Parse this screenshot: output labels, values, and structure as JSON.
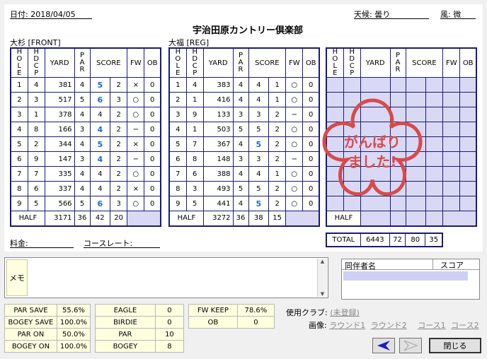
{
  "header": {
    "date_label": "日付: 2018/04/05",
    "weather_label": "天候: 曇り",
    "wind_label": "風: 微",
    "course_name": "宇治田原カントリー倶楽部"
  },
  "front": {
    "label": "大杉 [FRONT]",
    "columns": [
      "HOLE",
      "HDCP",
      "YARD",
      "PAR",
      "SCORE",
      "FW",
      "OB"
    ],
    "rows": [
      {
        "hole": "1",
        "hdcp": "4",
        "yard": "381",
        "par": "4",
        "score": "5",
        "putt": "2",
        "fw": "×",
        "ob": "0"
      },
      {
        "hole": "2",
        "hdcp": "3",
        "yard": "517",
        "par": "5",
        "score": "6",
        "putt": "3",
        "fw": "○",
        "ob": "0"
      },
      {
        "hole": "3",
        "hdcp": "1",
        "yard": "378",
        "par": "4",
        "score": "4",
        "putt": "2",
        "fw": "○",
        "ob": "0"
      },
      {
        "hole": "4",
        "hdcp": "8",
        "yard": "166",
        "par": "3",
        "score": "4",
        "putt": "2",
        "fw": "−",
        "ob": "0"
      },
      {
        "hole": "5",
        "hdcp": "2",
        "yard": "344",
        "par": "4",
        "score": "5",
        "putt": "2",
        "fw": "×",
        "ob": "0"
      },
      {
        "hole": "6",
        "hdcp": "9",
        "yard": "147",
        "par": "3",
        "score": "4",
        "putt": "2",
        "fw": "−",
        "ob": "0"
      },
      {
        "hole": "7",
        "hdcp": "7",
        "yard": "335",
        "par": "4",
        "score": "4",
        "putt": "2",
        "fw": "○",
        "ob": "0"
      },
      {
        "hole": "8",
        "hdcp": "6",
        "yard": "337",
        "par": "4",
        "score": "4",
        "putt": "2",
        "fw": "×",
        "ob": "0"
      },
      {
        "hole": "9",
        "hdcp": "5",
        "yard": "566",
        "par": "5",
        "score": "6",
        "putt": "3",
        "fw": "○",
        "ob": "0"
      }
    ],
    "half": {
      "label": "HALF",
      "yard": "3171",
      "par": "36",
      "score": "42",
      "putt": "20"
    }
  },
  "back": {
    "label": "大福 [REG]",
    "rows": [
      {
        "hole": "1",
        "hdcp": "4",
        "yard": "383",
        "par": "4",
        "score": "4",
        "putt": "1",
        "fw": "○",
        "ob": "0"
      },
      {
        "hole": "2",
        "hdcp": "1",
        "yard": "416",
        "par": "4",
        "score": "4",
        "putt": "1",
        "fw": "○",
        "ob": "0"
      },
      {
        "hole": "3",
        "hdcp": "9",
        "yard": "133",
        "par": "3",
        "score": "3",
        "putt": "2",
        "fw": "−",
        "ob": "0"
      },
      {
        "hole": "4",
        "hdcp": "1",
        "yard": "503",
        "par": "5",
        "score": "5",
        "putt": "2",
        "fw": "○",
        "ob": "0"
      },
      {
        "hole": "5",
        "hdcp": "7",
        "yard": "367",
        "par": "4",
        "score": "5",
        "putt": "2",
        "fw": "○",
        "ob": "0"
      },
      {
        "hole": "6",
        "hdcp": "8",
        "yard": "148",
        "par": "3",
        "score": "3",
        "putt": "2",
        "fw": "−",
        "ob": "0"
      },
      {
        "hole": "7",
        "hdcp": "6",
        "yard": "388",
        "par": "4",
        "score": "4",
        "putt": "1",
        "fw": "○",
        "ob": "0"
      },
      {
        "hole": "8",
        "hdcp": "3",
        "yard": "493",
        "par": "5",
        "score": "5",
        "putt": "2",
        "fw": "○",
        "ob": "0"
      },
      {
        "hole": "9",
        "hdcp": "5",
        "yard": "441",
        "par": "4",
        "score": "5",
        "putt": "2",
        "fw": "○",
        "ob": "0"
      }
    ],
    "half": {
      "label": "HALF",
      "yard": "3272",
      "par": "36",
      "score": "38",
      "putt": "15"
    }
  },
  "third": {
    "total": {
      "label": "TOTAL",
      "yard": "6443",
      "par": "72",
      "score": "80",
      "putt": "35"
    },
    "stamp_line1": "がんばり",
    "stamp_line2": "ました!",
    "stamp_color": "#d94a4a"
  },
  "fees": {
    "fee_label": "料金:",
    "rating_label": "コースレート:"
  },
  "memo": {
    "label": "メモ",
    "value": ""
  },
  "companions": {
    "col_name": "同伴者名",
    "col_score": "スコア"
  },
  "stats1": [
    {
      "label": "PAR SAVE",
      "value": "55.6%"
    },
    {
      "label": "BOGEY SAVE",
      "value": "100.0%"
    },
    {
      "label": "PAR ON",
      "value": "50.0%"
    },
    {
      "label": "BOGEY ON",
      "value": "100.0%"
    }
  ],
  "stats2": [
    {
      "label": "EAGLE",
      "value": "0"
    },
    {
      "label": "BIRDIE",
      "value": "0"
    },
    {
      "label": "PAR",
      "value": "10"
    },
    {
      "label": "BOGEY",
      "value": "8"
    }
  ],
  "stats3": [
    {
      "label": "FW KEEP",
      "value": "78.6%"
    },
    {
      "label": "OB",
      "value": "0"
    }
  ],
  "clubs": {
    "label": "使用クラブ:",
    "link": "(未登録)"
  },
  "images": {
    "label": "画像:",
    "links": [
      "ラウンド1",
      "ラウンド2",
      "コース1",
      "コース2"
    ]
  },
  "buttons": {
    "close": "閉じる"
  },
  "colors": {
    "border": "#1a1a7a",
    "score_blue": "#1a6ad4",
    "blank": "#d9d9f5"
  }
}
